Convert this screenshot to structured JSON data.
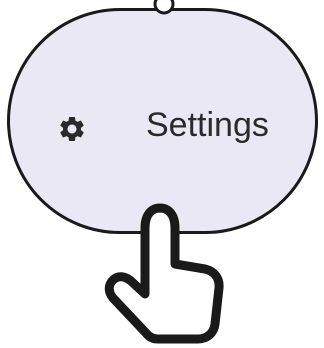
{
  "menu_item": {
    "label": "Settings",
    "icon": "gear-icon"
  },
  "pointer": {
    "icon": "hand-pointer-icon"
  },
  "colors": {
    "pill_fill": "#e9e8f4",
    "outline": "#1a1a1a",
    "label_text": "#2a2a2a"
  }
}
